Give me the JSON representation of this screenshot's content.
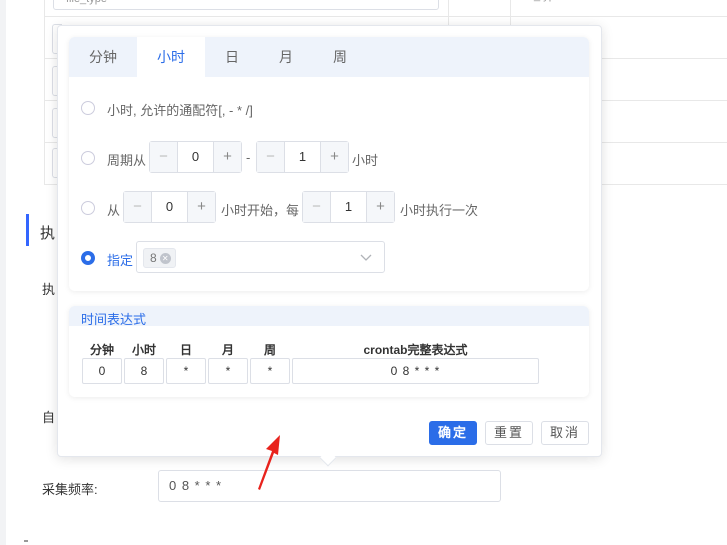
{
  "background": {
    "top_input_value": "file_type",
    "top_col_text": "file_type",
    "section_title": "执",
    "label_1": "执",
    "label_2": "自",
    "frequency_label": "采集频率:",
    "frequency_value": "0 8 * * *"
  },
  "tabs": [
    {
      "label": "分钟"
    },
    {
      "label": "小时"
    },
    {
      "label": "日"
    },
    {
      "label": "月"
    },
    {
      "label": "周"
    }
  ],
  "active_tab": "小时",
  "options": {
    "wildcard": "小时, 允许的通配符[, - * /]",
    "cycle": {
      "prefix": "周期从",
      "from": "0",
      "sep": "-",
      "to": "1",
      "suffix": "小时"
    },
    "interval": {
      "prefix": "从",
      "start": "0",
      "mid": "小时开始，每",
      "step": "1",
      "suffix": "小时执行一次"
    },
    "specify": {
      "label": "指定",
      "selected_tag": "8",
      "selected": true
    }
  },
  "expression": {
    "title": "时间表达式",
    "headers": [
      "分钟",
      "小时",
      "日",
      "月",
      "周",
      "crontab完整表达式"
    ],
    "values": [
      "0",
      "8",
      "*",
      "*",
      "*",
      "0 8 * * *"
    ]
  },
  "buttons": {
    "confirm": "确定",
    "reset": "重置",
    "cancel": "取消"
  },
  "colors": {
    "accent": "#2b6de8",
    "annotation_arrow": "#e8231d"
  }
}
